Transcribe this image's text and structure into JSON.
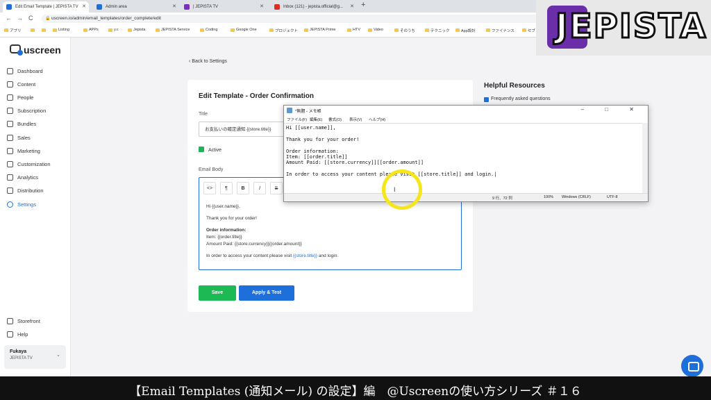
{
  "browser": {
    "tabs": [
      {
        "label": "Edit Email Template | JEPISTA TV"
      },
      {
        "label": "Admin area"
      },
      {
        "label": "| JEPISTA TV"
      },
      {
        "label": "Inbox (121) - jepista.official@g..."
      }
    ],
    "url": "uscreen.io/admin/email_templates/order_complete/edit",
    "new_tab": "+",
    "window_controls": "–  ❐  ✕",
    "nav": {
      "back": "←",
      "forward": "→",
      "reload": "C"
    },
    "bookmarks": [
      "アプリ",
      "",
      "",
      "Listing",
      "APPs",
      "y.c",
      "Jepista",
      "JEPISTA Service",
      "Coding",
      "Google One",
      "プロジェクト",
      "JEPISTA Prime",
      "HTV",
      "Video",
      "そのうち",
      "テクニック",
      "App設計",
      "ファイナンス",
      "セブ"
    ]
  },
  "overlay_logo": {
    "text": "JEPISTA",
    "brand_color": "#6a2ea8"
  },
  "sidebar": {
    "brand": "uscreen",
    "items": [
      {
        "label": "Dashboard",
        "icon": "dashboard-icon"
      },
      {
        "label": "Content",
        "icon": "content-icon"
      },
      {
        "label": "People",
        "icon": "people-icon"
      },
      {
        "label": "Subscription",
        "icon": "subscription-icon"
      },
      {
        "label": "Bundles",
        "icon": "bundles-icon"
      },
      {
        "label": "Sales",
        "icon": "sales-icon"
      },
      {
        "label": "Marketing",
        "icon": "marketing-icon"
      },
      {
        "label": "Customization",
        "icon": "customization-icon"
      },
      {
        "label": "Analytics",
        "icon": "analytics-icon"
      },
      {
        "label": "Distribution",
        "icon": "distribution-icon"
      },
      {
        "label": "Settings",
        "icon": "settings-icon",
        "active": true
      }
    ],
    "bottom_items": [
      {
        "label": "Storefront",
        "icon": "storefront-icon"
      },
      {
        "label": "Help",
        "icon": "help-icon"
      }
    ],
    "user": {
      "name": "Fukaya",
      "org": "JEPISTA TV",
      "chevron": "⌄"
    }
  },
  "main": {
    "back_link": "‹ Back to Settings",
    "card_title": "Edit Template - Order Confirmation",
    "title_label": "Title",
    "title_value": "お支払いの確定通知 {{store.title}}",
    "active_label": "Active",
    "body_label": "Email Body",
    "toolbar": [
      "<>",
      "¶",
      "B",
      "I",
      "S"
    ],
    "editor_lines": {
      "greeting": "Hi {{user.name}},",
      "thanks": "Thank you for your order!",
      "info_heading": "Order information:",
      "item": "Item: {{order.title}}",
      "amount": "Amount Paid: {{store.currency}}{{order.amount}}",
      "access_prefix": "In order to access your content please visit ",
      "access_var": "{{store.title}}",
      "access_suffix": " and login."
    },
    "save_label": "Save",
    "apply_label": "Apply & Test"
  },
  "resources": {
    "title": "Helpful Resources",
    "faq": "Frequently asked questions"
  },
  "notepad": {
    "title": "*無題 - メモ帳",
    "controls": "–  □  ✕",
    "menu": [
      "ファイル(F)",
      "編集(E)",
      "書式(O)",
      "表示(V)",
      "ヘルプ(H)"
    ],
    "lines": [
      "Hi [[user.name]],",
      "",
      "Thank you for your order!",
      "",
      "Order information:",
      "Item: [[order.title]]",
      "Amount Paid: [[store.currency]][[order.amount]]",
      "",
      "In order to access your content please visit [[store.title]] and login.|"
    ],
    "status": {
      "position": "9 行、72 列",
      "zoom": "100%",
      "eol": "Windows (CRLF)",
      "encoding": "UTF-8"
    }
  },
  "caption": "【Email Templates (通知メール) の設定】編　@Uscreenの使い方シリーズ ＃１６"
}
